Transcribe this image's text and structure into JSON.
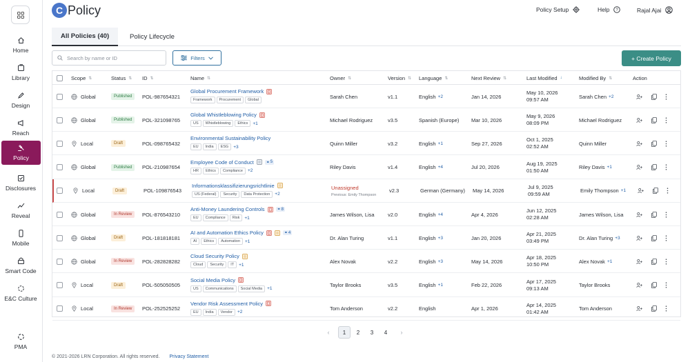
{
  "app": {
    "logo_letter": "C",
    "logo_text": "Policy"
  },
  "header": {
    "policy_setup": "Policy Setup",
    "help": "Help",
    "user": "Rajal Ajai"
  },
  "sidebar": [
    {
      "label": "Home",
      "icon": "home-icon"
    },
    {
      "label": "Library",
      "icon": "library-icon"
    },
    {
      "label": "Design",
      "icon": "pen-icon"
    },
    {
      "label": "Reach",
      "icon": "megaphone-icon"
    },
    {
      "label": "Policy",
      "icon": "gavel-icon",
      "active": true
    },
    {
      "label": "Disclosures",
      "icon": "disclosure-icon"
    },
    {
      "label": "Reveal",
      "icon": "chart-line-icon"
    },
    {
      "label": "Mobile",
      "icon": "mobile-icon"
    },
    {
      "label": "Smart Code",
      "icon": "code-icon"
    },
    {
      "label": "E&C Culture",
      "icon": "culture-icon"
    },
    {
      "label": "PMA",
      "icon": "pma-icon"
    }
  ],
  "tabs": [
    "All Policies (40)",
    "Policy Lifecycle"
  ],
  "toolbar": {
    "search_placeholder": "Search by name or ID",
    "filters": "Filters",
    "create": "+ Create Policy"
  },
  "columns": [
    "Scope",
    "Status",
    "ID",
    "Name",
    "Owner",
    "Version",
    "Language",
    "Next Review",
    "Last Modified",
    "Modified By",
    "Action"
  ],
  "rows": [
    {
      "scope": "Global",
      "status": "Published",
      "id": "POL-987654321",
      "name": "Global Procurement Framework",
      "name_icons": [
        "doc"
      ],
      "tags": [
        "Framework",
        "Procurement",
        "Global"
      ],
      "tags_more": "",
      "owner": "Sarah Chen",
      "version": "v1.1",
      "language": "English",
      "lang_more": "+2",
      "next_review": "Jan 14, 2026",
      "lm_date": "May 10, 2026",
      "lm_time": "09:57 AM",
      "modified_by": "Sarah Chen",
      "mb_more": "+2"
    },
    {
      "scope": "Global",
      "status": "Published",
      "id": "POL-321098765",
      "name": "Global Whistleblowing Policy",
      "name_icons": [
        "doc"
      ],
      "tags": [
        "US",
        "Whistleblowing",
        "Ethics"
      ],
      "tags_more": "+1",
      "owner": "Michael Rodriguez",
      "version": "v3.5",
      "language": "Spanish (Europe)",
      "lang_more": "",
      "next_review": "Mar 10, 2026",
      "lm_date": "May 9, 2026",
      "lm_time": "08:09 PM",
      "modified_by": "Michael Rodriguez",
      "mb_more": ""
    },
    {
      "scope": "Local",
      "status": "Draft",
      "id": "POL-098765432",
      "name": "Environmental Sustainability Policy",
      "name_icons": [],
      "tags": [
        "EU",
        "India",
        "ESG"
      ],
      "tags_more": "+3",
      "owner": "Quinn Miller",
      "version": "v3.2",
      "language": "English",
      "lang_more": "+1",
      "next_review": "Sep 27, 2026",
      "lm_date": "Oct 1, 2025",
      "lm_time": "02:52 AM",
      "modified_by": "Quinn Miller",
      "mb_more": ""
    },
    {
      "scope": "Global",
      "status": "Published",
      "id": "POL-210987654",
      "name": "Employee Code of Conduct",
      "name_icons": [
        "file",
        "link5"
      ],
      "tags": [
        "HR",
        "Ethics",
        "Compliance"
      ],
      "tags_more": "+2",
      "owner": "Riley Davis",
      "version": "v1.4",
      "language": "English",
      "lang_more": "+4",
      "next_review": "Jul 20, 2026",
      "lm_date": "Aug 19, 2025",
      "lm_time": "01:50 AM",
      "modified_by": "Riley Davis",
      "mb_more": "+1"
    },
    {
      "scope": "Local",
      "status": "Draft",
      "id": "POL-109876543",
      "name": "Informationsklassifizierungsrichtlinie",
      "name_icons": [
        "draft"
      ],
      "tags": [
        "US (Federal)",
        "Security",
        "Data Protection"
      ],
      "tags_more": "+2",
      "owner": "Unassigned",
      "owner_prev": "Previous: Emily Thompson",
      "version": "v2.3",
      "language": "German (Germany)",
      "lang_more": "",
      "next_review": "May 14, 2026",
      "lm_date": "Jul 9, 2025",
      "lm_time": "09:59 AM",
      "modified_by": "Emily Thompson",
      "mb_more": "+1",
      "flag": true
    },
    {
      "scope": "Global",
      "status": "In Review",
      "id": "POL-876543210",
      "name": "Anti-Money Laundering Controls",
      "name_icons": [
        "doc",
        "link8"
      ],
      "tags": [
        "EU",
        "Compliance",
        "Risk"
      ],
      "tags_more": "+1",
      "owner": "James Wilson, Lisa",
      "version": "v2.0",
      "language": "English",
      "lang_more": "+4",
      "next_review": "Apr 4, 2026",
      "lm_date": "Jun 12, 2025",
      "lm_time": "02:28 AM",
      "modified_by": "James Wilson, Lisa",
      "mb_more": ""
    },
    {
      "scope": "Global",
      "status": "Draft",
      "id": "POL-181818181",
      "name": "AI and Automation Ethics Policy",
      "name_icons": [
        "doc",
        "draft",
        "link4"
      ],
      "tags": [
        "AI",
        "Ethics",
        "Automation"
      ],
      "tags_more": "+1",
      "owner": "Dr. Alan Turing",
      "version": "v1.1",
      "language": "English",
      "lang_more": "+3",
      "next_review": "Jan 20, 2026",
      "lm_date": "Apr 21, 2025",
      "lm_time": "03:49 PM",
      "modified_by": "Dr. Alan Turing",
      "mb_more": "+3"
    },
    {
      "scope": "Global",
      "status": "In Review",
      "id": "POL-282828282",
      "name": "Cloud Security Policy",
      "name_icons": [
        "draft"
      ],
      "tags": [
        "Cloud",
        "Security",
        "IT"
      ],
      "tags_more": "+1",
      "owner": "Alex Novak",
      "version": "v2.2",
      "language": "English",
      "lang_more": "+3",
      "next_review": "May 14, 2026",
      "lm_date": "Apr 18, 2025",
      "lm_time": "10:50 PM",
      "modified_by": "Alex Novak",
      "mb_more": "+1"
    },
    {
      "scope": "Local",
      "status": "Draft",
      "id": "POL-505050505",
      "name": "Social Media Policy",
      "name_icons": [
        "doc"
      ],
      "tags": [
        "US",
        "Communications",
        "Social Media"
      ],
      "tags_more": "+1",
      "owner": "Taylor Brooks",
      "version": "v3.5",
      "language": "English",
      "lang_more": "+1",
      "next_review": "Feb 22, 2026",
      "lm_date": "Apr 17, 2025",
      "lm_time": "09:13 AM",
      "modified_by": "Taylor Brooks",
      "mb_more": ""
    },
    {
      "scope": "Local",
      "status": "In Review",
      "id": "POL-252525252",
      "name": "Vendor Risk Assessment Policy",
      "name_icons": [
        "doc"
      ],
      "tags": [
        "EU",
        "India",
        "Vendor"
      ],
      "tags_more": "+2",
      "owner": "Tom Anderson",
      "version": "v2.2",
      "language": "English",
      "lang_more": "",
      "next_review": "Apr 1, 2026",
      "lm_date": "Apr 14, 2025",
      "lm_time": "01:42 AM",
      "modified_by": "Tom Anderson",
      "mb_more": ""
    }
  ],
  "pagination": {
    "pages": [
      "1",
      "2",
      "3",
      "4"
    ],
    "current": "1"
  },
  "footer": {
    "copyright": "© 2021-2026 LRN Corporation. All rights reserved.",
    "privacy": "Privacy Statement"
  }
}
